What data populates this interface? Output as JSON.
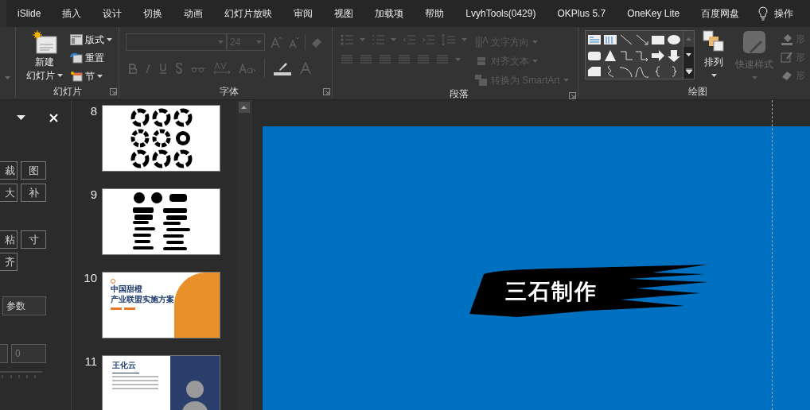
{
  "menu_tabs": [
    {
      "label": "iSlide"
    },
    {
      "label": "插入"
    },
    {
      "label": "设计"
    },
    {
      "label": "切换"
    },
    {
      "label": "动画"
    },
    {
      "label": "幻灯片放映"
    },
    {
      "label": "审阅"
    },
    {
      "label": "视图"
    },
    {
      "label": "加载项"
    },
    {
      "label": "帮助"
    },
    {
      "label": "LvyhTools(0429)"
    },
    {
      "label": "OKPlus 5.7"
    },
    {
      "label": "OneKey Lite"
    },
    {
      "label": "百度网盘"
    }
  ],
  "tell_me": {
    "label": "操作"
  },
  "ribbon": {
    "slides_group": {
      "label": "幻灯片",
      "new_slide": [
        "新建",
        "幻灯片"
      ],
      "commands": [
        {
          "label": "版式",
          "dropdown": true
        },
        {
          "label": "重置",
          "dropdown": false
        },
        {
          "label": "节",
          "dropdown": true
        }
      ]
    },
    "font_group": {
      "label": "字体",
      "font_size": "24",
      "disabled": true
    },
    "paragraph_group": {
      "label": "段落",
      "commands": [
        {
          "label": "文字方向",
          "disabled": true
        },
        {
          "label": "对齐文本",
          "disabled": true
        },
        {
          "label": "转换为 SmartArt",
          "disabled": true
        }
      ]
    },
    "drawing_group": {
      "label": "绘图",
      "arrange": "排列",
      "quick_styles": {
        "label": "快速样式",
        "disabled": true
      },
      "shape_commands": [
        {
          "label": "形",
          "disabled": true
        },
        {
          "label": "形",
          "disabled": true
        },
        {
          "label": "形",
          "disabled": true
        }
      ]
    }
  },
  "side_pane": {
    "button_rows": [
      [
        {
          "label": "裁"
        },
        {
          "label": "图"
        }
      ],
      [
        {
          "label": "大"
        },
        {
          "label": "补"
        }
      ],
      [
        {
          "label": "粘"
        },
        {
          "label": "寸"
        }
      ],
      [
        {
          "label": "齐"
        }
      ]
    ],
    "param_field": {
      "value": "参数"
    },
    "number_field": {
      "value": "0"
    }
  },
  "slides": [
    {
      "number": "8",
      "kind": "circles"
    },
    {
      "number": "9",
      "kind": "strokes"
    },
    {
      "number": "10",
      "kind": "orange",
      "title_lines": [
        "中国甜橙",
        "产业联盟实施方案"
      ]
    },
    {
      "number": "11",
      "kind": "profile",
      "name": "王化云"
    }
  ],
  "current_slide": {
    "text": "三石制作"
  }
}
